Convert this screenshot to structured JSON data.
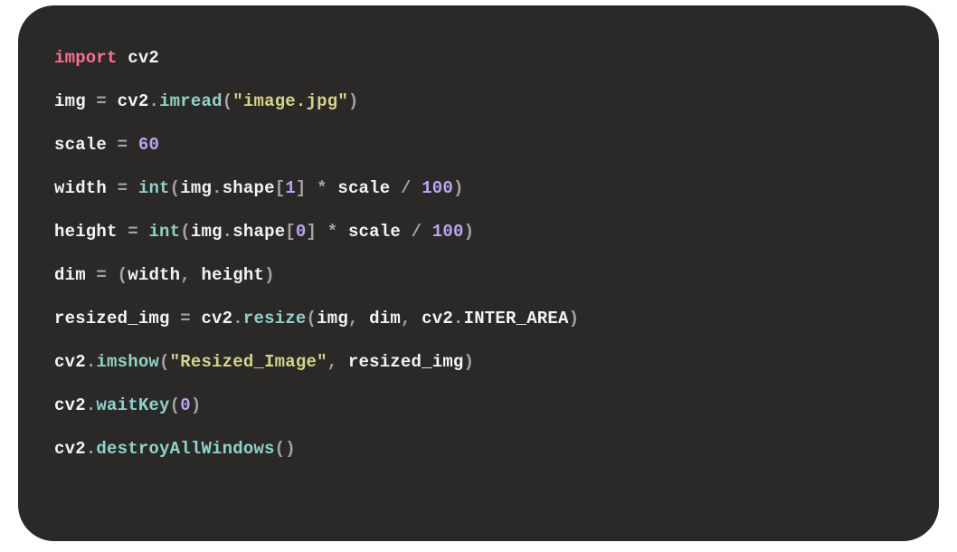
{
  "code": {
    "lines": [
      [
        {
          "cls": "tok-keyword",
          "t": "import"
        },
        {
          "cls": "tok-default",
          "t": " cv2"
        }
      ],
      [
        {
          "cls": "tok-default",
          "t": "img "
        },
        {
          "cls": "tok-punct",
          "t": "="
        },
        {
          "cls": "tok-default",
          "t": " cv2"
        },
        {
          "cls": "tok-punct",
          "t": "."
        },
        {
          "cls": "tok-method",
          "t": "imread"
        },
        {
          "cls": "tok-punct",
          "t": "("
        },
        {
          "cls": "tok-string",
          "t": "\"image.jpg\""
        },
        {
          "cls": "tok-punct",
          "t": ")"
        }
      ],
      [
        {
          "cls": "tok-default",
          "t": "scale "
        },
        {
          "cls": "tok-punct",
          "t": "="
        },
        {
          "cls": "tok-default",
          "t": " "
        },
        {
          "cls": "tok-number",
          "t": "60"
        }
      ],
      [
        {
          "cls": "tok-default",
          "t": "width "
        },
        {
          "cls": "tok-punct",
          "t": "="
        },
        {
          "cls": "tok-default",
          "t": " "
        },
        {
          "cls": "tok-method",
          "t": "int"
        },
        {
          "cls": "tok-punct",
          "t": "("
        },
        {
          "cls": "tok-default",
          "t": "img"
        },
        {
          "cls": "tok-punct",
          "t": "."
        },
        {
          "cls": "tok-default",
          "t": "shape"
        },
        {
          "cls": "tok-punct",
          "t": "["
        },
        {
          "cls": "tok-number",
          "t": "1"
        },
        {
          "cls": "tok-punct",
          "t": "]"
        },
        {
          "cls": "tok-default",
          "t": " "
        },
        {
          "cls": "tok-punct",
          "t": "*"
        },
        {
          "cls": "tok-default",
          "t": " scale "
        },
        {
          "cls": "tok-punct",
          "t": "/"
        },
        {
          "cls": "tok-default",
          "t": " "
        },
        {
          "cls": "tok-number",
          "t": "100"
        },
        {
          "cls": "tok-punct",
          "t": ")"
        }
      ],
      [
        {
          "cls": "tok-default",
          "t": "height "
        },
        {
          "cls": "tok-punct",
          "t": "="
        },
        {
          "cls": "tok-default",
          "t": " "
        },
        {
          "cls": "tok-method",
          "t": "int"
        },
        {
          "cls": "tok-punct",
          "t": "("
        },
        {
          "cls": "tok-default",
          "t": "img"
        },
        {
          "cls": "tok-punct",
          "t": "."
        },
        {
          "cls": "tok-default",
          "t": "shape"
        },
        {
          "cls": "tok-punct",
          "t": "["
        },
        {
          "cls": "tok-number",
          "t": "0"
        },
        {
          "cls": "tok-punct",
          "t": "]"
        },
        {
          "cls": "tok-default",
          "t": " "
        },
        {
          "cls": "tok-punct",
          "t": "*"
        },
        {
          "cls": "tok-default",
          "t": " scale "
        },
        {
          "cls": "tok-punct",
          "t": "/"
        },
        {
          "cls": "tok-default",
          "t": " "
        },
        {
          "cls": "tok-number",
          "t": "100"
        },
        {
          "cls": "tok-punct",
          "t": ")"
        }
      ],
      [
        {
          "cls": "tok-default",
          "t": "dim "
        },
        {
          "cls": "tok-punct",
          "t": "="
        },
        {
          "cls": "tok-default",
          "t": " "
        },
        {
          "cls": "tok-punct",
          "t": "("
        },
        {
          "cls": "tok-default",
          "t": "width"
        },
        {
          "cls": "tok-punct",
          "t": ","
        },
        {
          "cls": "tok-default",
          "t": " height"
        },
        {
          "cls": "tok-punct",
          "t": ")"
        }
      ],
      [
        {
          "cls": "tok-default",
          "t": "resized_img "
        },
        {
          "cls": "tok-punct",
          "t": "="
        },
        {
          "cls": "tok-default",
          "t": " cv2"
        },
        {
          "cls": "tok-punct",
          "t": "."
        },
        {
          "cls": "tok-method",
          "t": "resize"
        },
        {
          "cls": "tok-punct",
          "t": "("
        },
        {
          "cls": "tok-default",
          "t": "img"
        },
        {
          "cls": "tok-punct",
          "t": ","
        },
        {
          "cls": "tok-default",
          "t": " dim"
        },
        {
          "cls": "tok-punct",
          "t": ","
        },
        {
          "cls": "tok-default",
          "t": " cv2"
        },
        {
          "cls": "tok-punct",
          "t": "."
        },
        {
          "cls": "tok-default",
          "t": "INTER_AREA"
        },
        {
          "cls": "tok-punct",
          "t": ")"
        }
      ],
      [
        {
          "cls": "tok-default",
          "t": "cv2"
        },
        {
          "cls": "tok-punct",
          "t": "."
        },
        {
          "cls": "tok-method",
          "t": "imshow"
        },
        {
          "cls": "tok-punct",
          "t": "("
        },
        {
          "cls": "tok-string",
          "t": "\"Resized_Image\""
        },
        {
          "cls": "tok-punct",
          "t": ","
        },
        {
          "cls": "tok-default",
          "t": " resized_img"
        },
        {
          "cls": "tok-punct",
          "t": ")"
        }
      ],
      [
        {
          "cls": "tok-default",
          "t": "cv2"
        },
        {
          "cls": "tok-punct",
          "t": "."
        },
        {
          "cls": "tok-method",
          "t": "waitKey"
        },
        {
          "cls": "tok-punct",
          "t": "("
        },
        {
          "cls": "tok-number",
          "t": "0"
        },
        {
          "cls": "tok-punct",
          "t": ")"
        }
      ],
      [
        {
          "cls": "tok-default",
          "t": "cv2"
        },
        {
          "cls": "tok-punct",
          "t": "."
        },
        {
          "cls": "tok-method",
          "t": "destroyAllWindows"
        },
        {
          "cls": "tok-punct",
          "t": "()"
        }
      ]
    ]
  },
  "colors": {
    "background": "#2b2927",
    "keyword": "#f96f8f",
    "default": "#f3f3f2",
    "punct": "#a4a4a3",
    "method": "#8fd3c9",
    "string": "#d5d38a",
    "number": "#b7a6f0"
  }
}
